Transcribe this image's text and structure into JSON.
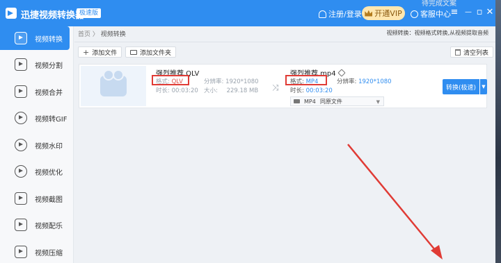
{
  "app": {
    "title": "迅捷视频转换器",
    "badge": "极速版",
    "login": "注册/登录",
    "vip": "开通VIP",
    "service": "客服中心",
    "menu_glyph": "≡",
    "minimize_glyph": "—",
    "maximize_glyph": "▫",
    "close_glyph": "✕",
    "brand_color": "#2f8df0"
  },
  "desktop": {
    "text": "待完成文案"
  },
  "sidebar": {
    "items": [
      {
        "label": "视频转换",
        "icon": "convert-icon",
        "active": true
      },
      {
        "label": "视频分割",
        "icon": "split-icon"
      },
      {
        "label": "视频合并",
        "icon": "merge-icon"
      },
      {
        "label": "视频转GIF",
        "icon": "gif-icon"
      },
      {
        "label": "视频水印",
        "icon": "watermark-icon"
      },
      {
        "label": "视频优化",
        "icon": "optimize-icon"
      },
      {
        "label": "视频截图",
        "icon": "screenshot-icon"
      },
      {
        "label": "视频配乐",
        "icon": "music-icon"
      },
      {
        "label": "视频压缩",
        "icon": "compress-icon"
      }
    ]
  },
  "main": {
    "breadcrumb_home": "首页",
    "breadcrumb_sep": "〉",
    "breadcrumb_current": "视频转换",
    "hint": "视频转换：视频格式转换,从视频提取音频",
    "add_file": "添加文件",
    "add_folder": "添加文件夹",
    "clear_list": "清空列表"
  },
  "file": {
    "source_name": "强烈推荐.QLV",
    "format_label": "格式:",
    "format_value": "QLV",
    "resolution_label": "分辨率:",
    "resolution_value": "1920*1080",
    "duration_label": "时长:",
    "duration_value": "00:03:20",
    "size_label": "大小:",
    "size_value": "229.18 MB",
    "output_name": "强烈推荐.mp4",
    "output_format_label": "格式:",
    "output_format_value": "MP4",
    "output_resolution_label": "分辨率:",
    "output_resolution_value": "1920*1080",
    "output_duration_label": "时长:",
    "output_duration_value": "00:03:20",
    "select_format": "MP4",
    "select_quality": "同原文件",
    "convert_button": "转换(极速)",
    "convert_dropdown": "▼"
  }
}
